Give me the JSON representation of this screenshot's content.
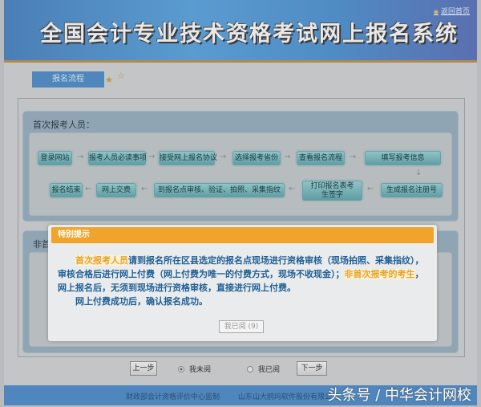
{
  "header": {
    "title": "全国会计专业技术资格考试网上报名系统",
    "home_link": "返回首页"
  },
  "tab": {
    "label": "报名流程"
  },
  "first_time": {
    "title": "首次报考人员：",
    "row1": [
      "登录网站",
      "报考人员必读事项",
      "接受网上报名协议",
      "选择报考省份",
      "查看报名流程",
      "填写报考信息"
    ],
    "row2": [
      "报名结束",
      "网上交费",
      "到报名点审核、验证、拍照、采集指纹",
      "打印报名表考生签字",
      "生成报名注册号"
    ]
  },
  "non_first_time": {
    "title": "非首次报考人员："
  },
  "modal": {
    "title": "特别提示",
    "p1_hl1": "首次报考人员",
    "p1_text1": "请到报名所在区县选定的报名点现场进行资格审核（现场拍照、采集指纹），审核合格后进行网上付费（网上付费为唯一的付费方式，现场不收现金）；",
    "p1_hl2": "非首次报考的考生",
    "p1_text2": "，网上报名后，无须到现场进行资格审核，直接进行网上付费。",
    "p2": "网上付费成功后，确认报名成功。",
    "read_button": "我已阅 (9)"
  },
  "controls": {
    "prev": "上一步",
    "next": "下一步",
    "radio_unread": "我未阅",
    "radio_read": "我已阅",
    "selected": "我未阅"
  },
  "footer": {
    "left": "财政部会计资格评价中心监制",
    "right": "山东山大鸥玛软件股份有限公司"
  },
  "watermark": "头条号 / 中华会计网校"
}
